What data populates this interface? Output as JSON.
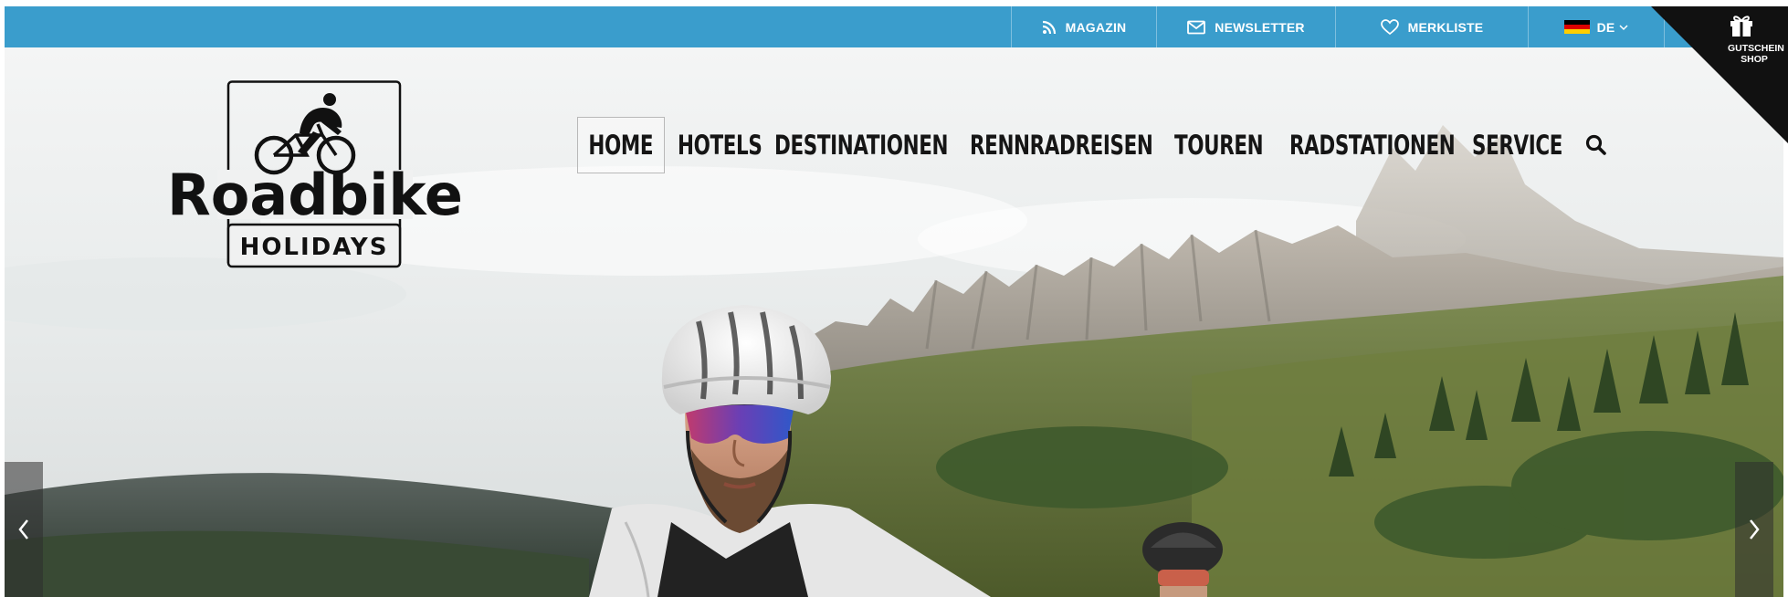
{
  "topbar": {
    "items": [
      {
        "label": "MAGAZIN",
        "icon": "rss-icon"
      },
      {
        "label": "NEWSLETTER",
        "icon": "mail-icon"
      },
      {
        "label": "MERKLISTE",
        "icon": "heart-icon"
      },
      {
        "label": "DE",
        "icon": "german-flag-icon",
        "dropdown": true
      }
    ],
    "color": "#3a9dcc"
  },
  "corner_badge": {
    "line1": "GUTSCHEIN",
    "line2": "SHOP",
    "icon": "gift-icon"
  },
  "logo": {
    "wordmark": "Roadbike",
    "subline": "HOLIDAYS",
    "icon": "cyclist-icon"
  },
  "main_nav": {
    "items": [
      {
        "label": "HOME",
        "active": true
      },
      {
        "label": "HOTELS",
        "active": false
      },
      {
        "label": "DESTINATIONEN",
        "active": false
      },
      {
        "label": "RENNRADREISEN",
        "active": false
      },
      {
        "label": "TOUREN",
        "active": false
      },
      {
        "label": "RADSTATIONEN",
        "active": false
      },
      {
        "label": "SERVICE",
        "active": false
      }
    ],
    "search_icon": "search-icon"
  },
  "slider": {
    "prev_icon": "chevron-left-icon",
    "next_icon": "chevron-right-icon"
  }
}
